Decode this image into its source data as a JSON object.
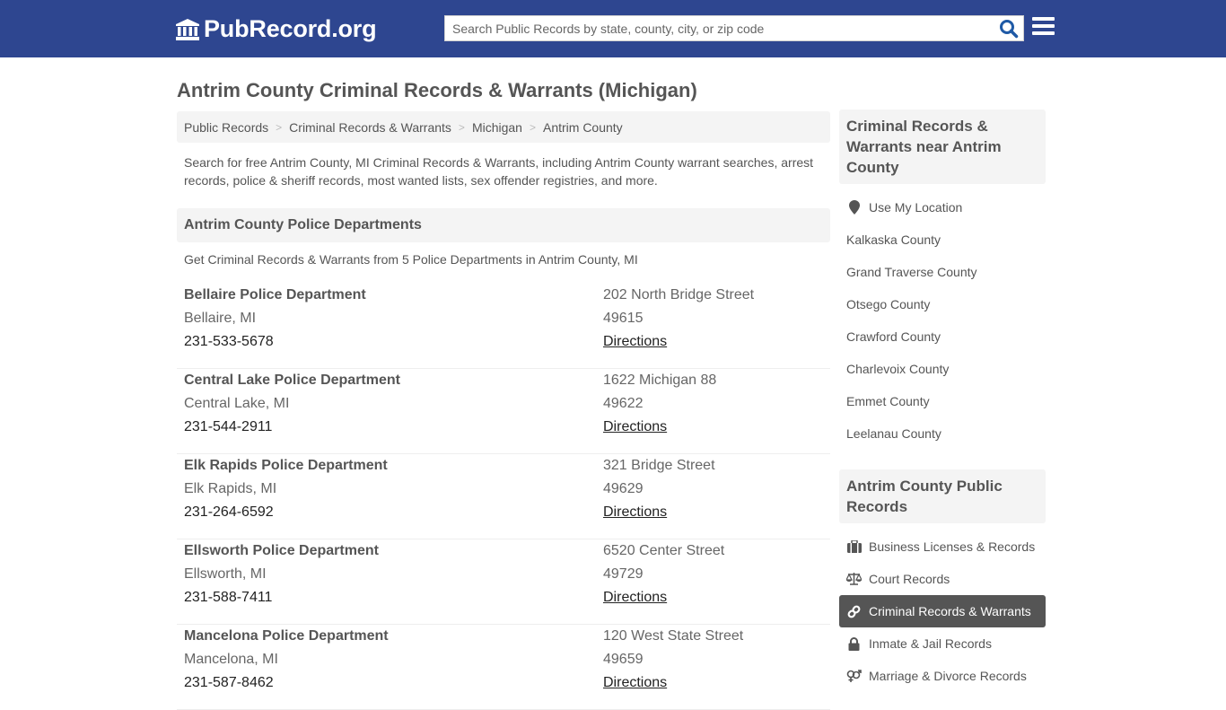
{
  "header": {
    "logo_text": "PubRecord.org",
    "search_placeholder": "Search Public Records by state, county, city, or zip code",
    "search_icon": "search-icon",
    "menu_icon": "hamburger-menu-icon",
    "brand_color": "#2e4690"
  },
  "page": {
    "title": "Antrim County Criminal Records & Warrants (Michigan)",
    "breadcrumb": [
      "Public Records",
      "Criminal Records & Warrants",
      "Michigan",
      "Antrim County"
    ],
    "intro": "Search for free Antrim County, MI Criminal Records & Warrants, including Antrim County warrant searches, arrest records, police & sheriff records, most wanted lists, sex offender registries, and more."
  },
  "police": {
    "heading": "Antrim County Police Departments",
    "subheading": "Get Criminal Records & Warrants from 5 Police Departments in Antrim County, MI",
    "departments": [
      {
        "name": "Bellaire Police Department",
        "city": "Bellaire, MI",
        "phone": "231-533-5678",
        "address": "202 North Bridge Street",
        "zip": "49615",
        "link": "Directions"
      },
      {
        "name": "Central Lake Police Department",
        "city": "Central Lake, MI",
        "phone": "231-544-2911",
        "address": "1622 Michigan 88",
        "zip": "49622",
        "link": "Directions"
      },
      {
        "name": "Elk Rapids Police Department",
        "city": "Elk Rapids, MI",
        "phone": "231-264-6592",
        "address": "321 Bridge Street",
        "zip": "49629",
        "link": "Directions"
      },
      {
        "name": "Ellsworth Police Department",
        "city": "Ellsworth, MI",
        "phone": "231-588-7411",
        "address": "6520 Center Street",
        "zip": "49729",
        "link": "Directions"
      },
      {
        "name": "Mancelona Police Department",
        "city": "Mancelona, MI",
        "phone": "231-587-8462",
        "address": "120 West State Street",
        "zip": "49659",
        "link": "Directions"
      }
    ]
  },
  "sidebar": {
    "nearby": {
      "heading": "Criminal Records & Warrants near Antrim County",
      "location_label": "Use My Location",
      "location_icon": "map-marker-icon",
      "counties": [
        "Kalkaska County",
        "Grand Traverse County",
        "Otsego County",
        "Crawford County",
        "Charlevoix County",
        "Emmet County",
        "Leelanau County"
      ]
    },
    "public_records": {
      "heading": "Antrim County Public Records",
      "items": [
        {
          "label": "Business Licenses & Records",
          "icon": "briefcase-icon",
          "active": false
        },
        {
          "label": "Court Records",
          "icon": "scales-icon",
          "active": false
        },
        {
          "label": "Criminal Records & Warrants",
          "icon": "link-icon",
          "active": true
        },
        {
          "label": "Inmate & Jail Records",
          "icon": "lock-icon",
          "active": false
        },
        {
          "label": "Marriage & Divorce Records",
          "icon": "gender-icon",
          "active": false
        }
      ]
    }
  }
}
